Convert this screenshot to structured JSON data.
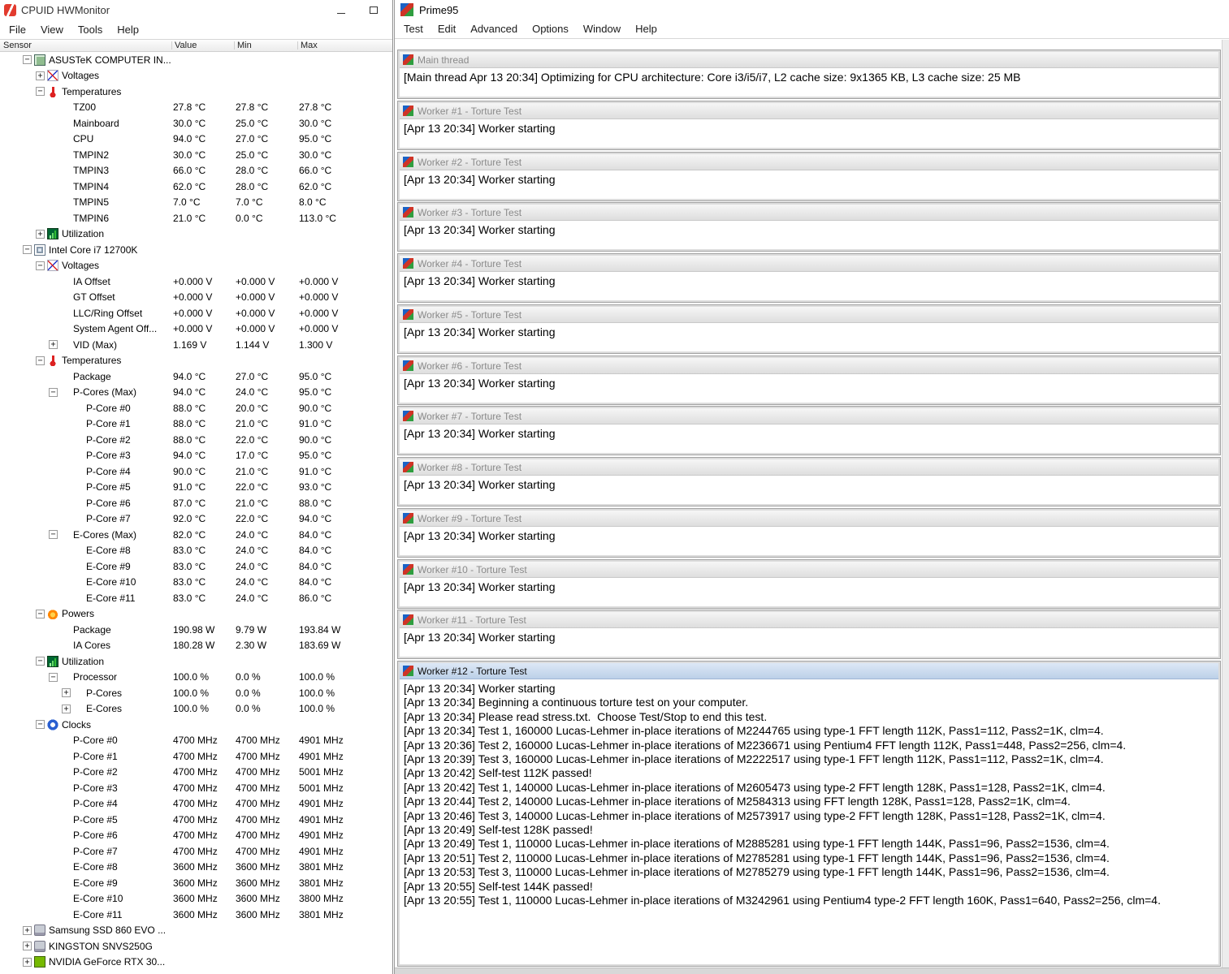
{
  "colors": {
    "active_child_titlebar": "#c6d9f1",
    "inactive_child_titlebar": "#e3e3e3",
    "hwmonitor_icon_red": "#e23b2e",
    "nvidia_green": "#76b900"
  },
  "hwmonitor": {
    "title": "CPUID HWMonitor",
    "menus": [
      "File",
      "View",
      "Tools",
      "Help"
    ],
    "columns": [
      "Sensor",
      "Value",
      "Min",
      "Max"
    ],
    "window_buttons": [
      "minimize-icon",
      "maximize-icon"
    ],
    "rows": [
      {
        "label": "ASUSTeK COMPUTER IN...",
        "level": 0,
        "exp": "open",
        "icon": "mainboard-icon",
        "value": "",
        "min": "",
        "max": ""
      },
      {
        "label": "Voltages",
        "level": 1,
        "exp": "closed",
        "icon": "voltage-icon",
        "value": "",
        "min": "",
        "max": ""
      },
      {
        "label": "Temperatures",
        "level": 1,
        "exp": "open",
        "icon": "temperature-icon",
        "value": "",
        "min": "",
        "max": ""
      },
      {
        "label": "TZ00",
        "level": 2,
        "exp": "",
        "icon": "",
        "value": "27.8 °C",
        "min": "27.8 °C",
        "max": "27.8 °C"
      },
      {
        "label": "Mainboard",
        "level": 2,
        "exp": "",
        "icon": "",
        "value": "30.0 °C",
        "min": "25.0 °C",
        "max": "30.0 °C"
      },
      {
        "label": "CPU",
        "level": 2,
        "exp": "",
        "icon": "",
        "value": "94.0 °C",
        "min": "27.0 °C",
        "max": "95.0 °C"
      },
      {
        "label": "TMPIN2",
        "level": 2,
        "exp": "",
        "icon": "",
        "value": "30.0 °C",
        "min": "25.0 °C",
        "max": "30.0 °C"
      },
      {
        "label": "TMPIN3",
        "level": 2,
        "exp": "",
        "icon": "",
        "value": "66.0 °C",
        "min": "28.0 °C",
        "max": "66.0 °C"
      },
      {
        "label": "TMPIN4",
        "level": 2,
        "exp": "",
        "icon": "",
        "value": "62.0 °C",
        "min": "28.0 °C",
        "max": "62.0 °C"
      },
      {
        "label": "TMPIN5",
        "level": 2,
        "exp": "",
        "icon": "",
        "value": "7.0 °C",
        "min": "7.0 °C",
        "max": "8.0 °C"
      },
      {
        "label": "TMPIN6",
        "level": 2,
        "exp": "",
        "icon": "",
        "value": "21.0 °C",
        "min": "0.0 °C",
        "max": "113.0 °C"
      },
      {
        "label": "Utilization",
        "level": 1,
        "exp": "closed",
        "icon": "utilization-icon",
        "value": "",
        "min": "",
        "max": ""
      },
      {
        "label": "Intel Core i7 12700K",
        "level": 0,
        "exp": "open",
        "icon": "cpu-icon",
        "value": "",
        "min": "",
        "max": ""
      },
      {
        "label": "Voltages",
        "level": 1,
        "exp": "open",
        "icon": "voltage-icon",
        "value": "",
        "min": "",
        "max": ""
      },
      {
        "label": "IA Offset",
        "level": 2,
        "exp": "",
        "icon": "",
        "value": "+0.000 V",
        "min": "+0.000 V",
        "max": "+0.000 V"
      },
      {
        "label": "GT Offset",
        "level": 2,
        "exp": "",
        "icon": "",
        "value": "+0.000 V",
        "min": "+0.000 V",
        "max": "+0.000 V"
      },
      {
        "label": "LLC/Ring Offset",
        "level": 2,
        "exp": "",
        "icon": "",
        "value": "+0.000 V",
        "min": "+0.000 V",
        "max": "+0.000 V"
      },
      {
        "label": "System Agent Off...",
        "level": 2,
        "exp": "",
        "icon": "",
        "value": "+0.000 V",
        "min": "+0.000 V",
        "max": "+0.000 V"
      },
      {
        "label": "VID (Max)",
        "level": 2,
        "exp": "closed",
        "icon": "",
        "value": "1.169 V",
        "min": "1.144 V",
        "max": "1.300 V"
      },
      {
        "label": "Temperatures",
        "level": 1,
        "exp": "open",
        "icon": "temperature-icon",
        "value": "",
        "min": "",
        "max": ""
      },
      {
        "label": "Package",
        "level": 2,
        "exp": "",
        "icon": "",
        "value": "94.0 °C",
        "min": "27.0 °C",
        "max": "95.0 °C"
      },
      {
        "label": "P-Cores (Max)",
        "level": 2,
        "exp": "open",
        "icon": "",
        "value": "94.0 °C",
        "min": "24.0 °C",
        "max": "95.0 °C"
      },
      {
        "label": "P-Core #0",
        "level": 3,
        "exp": "",
        "icon": "",
        "value": "88.0 °C",
        "min": "20.0 °C",
        "max": "90.0 °C"
      },
      {
        "label": "P-Core #1",
        "level": 3,
        "exp": "",
        "icon": "",
        "value": "88.0 °C",
        "min": "21.0 °C",
        "max": "91.0 °C"
      },
      {
        "label": "P-Core #2",
        "level": 3,
        "exp": "",
        "icon": "",
        "value": "88.0 °C",
        "min": "22.0 °C",
        "max": "90.0 °C"
      },
      {
        "label": "P-Core #3",
        "level": 3,
        "exp": "",
        "icon": "",
        "value": "94.0 °C",
        "min": "17.0 °C",
        "max": "95.0 °C"
      },
      {
        "label": "P-Core #4",
        "level": 3,
        "exp": "",
        "icon": "",
        "value": "90.0 °C",
        "min": "21.0 °C",
        "max": "91.0 °C"
      },
      {
        "label": "P-Core #5",
        "level": 3,
        "exp": "",
        "icon": "",
        "value": "91.0 °C",
        "min": "22.0 °C",
        "max": "93.0 °C"
      },
      {
        "label": "P-Core #6",
        "level": 3,
        "exp": "",
        "icon": "",
        "value": "87.0 °C",
        "min": "21.0 °C",
        "max": "88.0 °C"
      },
      {
        "label": "P-Core #7",
        "level": 3,
        "exp": "",
        "icon": "",
        "value": "92.0 °C",
        "min": "22.0 °C",
        "max": "94.0 °C"
      },
      {
        "label": "E-Cores (Max)",
        "level": 2,
        "exp": "open",
        "icon": "",
        "value": "82.0 °C",
        "min": "24.0 °C",
        "max": "84.0 °C"
      },
      {
        "label": "E-Core #8",
        "level": 3,
        "exp": "",
        "icon": "",
        "value": "83.0 °C",
        "min": "24.0 °C",
        "max": "84.0 °C"
      },
      {
        "label": "E-Core #9",
        "level": 3,
        "exp": "",
        "icon": "",
        "value": "83.0 °C",
        "min": "24.0 °C",
        "max": "84.0 °C"
      },
      {
        "label": "E-Core #10",
        "level": 3,
        "exp": "",
        "icon": "",
        "value": "83.0 °C",
        "min": "24.0 °C",
        "max": "84.0 °C"
      },
      {
        "label": "E-Core #11",
        "level": 3,
        "exp": "",
        "icon": "",
        "value": "83.0 °C",
        "min": "24.0 °C",
        "max": "86.0 °C"
      },
      {
        "label": "Powers",
        "level": 1,
        "exp": "open",
        "icon": "power-icon",
        "value": "",
        "min": "",
        "max": ""
      },
      {
        "label": "Package",
        "level": 2,
        "exp": "",
        "icon": "",
        "value": "190.98 W",
        "min": "9.79 W",
        "max": "193.84 W"
      },
      {
        "label": "IA Cores",
        "level": 2,
        "exp": "",
        "icon": "",
        "value": "180.28 W",
        "min": "2.30 W",
        "max": "183.69 W"
      },
      {
        "label": "Utilization",
        "level": 1,
        "exp": "open",
        "icon": "utilization-icon",
        "value": "",
        "min": "",
        "max": ""
      },
      {
        "label": "Processor",
        "level": 2,
        "exp": "open",
        "icon": "",
        "value": "100.0 %",
        "min": "0.0 %",
        "max": "100.0 %"
      },
      {
        "label": "P-Cores",
        "level": 3,
        "exp": "closed",
        "icon": "",
        "value": "100.0 %",
        "min": "0.0 %",
        "max": "100.0 %"
      },
      {
        "label": "E-Cores",
        "level": 3,
        "exp": "closed",
        "icon": "",
        "value": "100.0 %",
        "min": "0.0 %",
        "max": "100.0 %"
      },
      {
        "label": "Clocks",
        "level": 1,
        "exp": "open",
        "icon": "clock-icon",
        "value": "",
        "min": "",
        "max": ""
      },
      {
        "label": "P-Core #0",
        "level": 2,
        "exp": "",
        "icon": "",
        "value": "4700 MHz",
        "min": "4700 MHz",
        "max": "4901 MHz"
      },
      {
        "label": "P-Core #1",
        "level": 2,
        "exp": "",
        "icon": "",
        "value": "4700 MHz",
        "min": "4700 MHz",
        "max": "4901 MHz"
      },
      {
        "label": "P-Core #2",
        "level": 2,
        "exp": "",
        "icon": "",
        "value": "4700 MHz",
        "min": "4700 MHz",
        "max": "5001 MHz"
      },
      {
        "label": "P-Core #3",
        "level": 2,
        "exp": "",
        "icon": "",
        "value": "4700 MHz",
        "min": "4700 MHz",
        "max": "5001 MHz"
      },
      {
        "label": "P-Core #4",
        "level": 2,
        "exp": "",
        "icon": "",
        "value": "4700 MHz",
        "min": "4700 MHz",
        "max": "4901 MHz"
      },
      {
        "label": "P-Core #5",
        "level": 2,
        "exp": "",
        "icon": "",
        "value": "4700 MHz",
        "min": "4700 MHz",
        "max": "4901 MHz"
      },
      {
        "label": "P-Core #6",
        "level": 2,
        "exp": "",
        "icon": "",
        "value": "4700 MHz",
        "min": "4700 MHz",
        "max": "4901 MHz"
      },
      {
        "label": "P-Core #7",
        "level": 2,
        "exp": "",
        "icon": "",
        "value": "4700 MHz",
        "min": "4700 MHz",
        "max": "4901 MHz"
      },
      {
        "label": "E-Core #8",
        "level": 2,
        "exp": "",
        "icon": "",
        "value": "3600 MHz",
        "min": "3600 MHz",
        "max": "3801 MHz"
      },
      {
        "label": "E-Core #9",
        "level": 2,
        "exp": "",
        "icon": "",
        "value": "3600 MHz",
        "min": "3600 MHz",
        "max": "3801 MHz"
      },
      {
        "label": "E-Core #10",
        "level": 2,
        "exp": "",
        "icon": "",
        "value": "3600 MHz",
        "min": "3600 MHz",
        "max": "3800 MHz"
      },
      {
        "label": "E-Core #11",
        "level": 2,
        "exp": "",
        "icon": "",
        "value": "3600 MHz",
        "min": "3600 MHz",
        "max": "3801 MHz"
      },
      {
        "label": "Samsung SSD 860 EVO ...",
        "level": 0,
        "exp": "closed",
        "icon": "disk-icon",
        "value": "",
        "min": "",
        "max": ""
      },
      {
        "label": "KINGSTON SNVS250G",
        "level": 0,
        "exp": "closed",
        "icon": "disk-icon",
        "value": "",
        "min": "",
        "max": ""
      },
      {
        "label": "NVIDIA GeForce RTX 30...",
        "level": 0,
        "exp": "closed",
        "icon": "gpu-icon",
        "value": "",
        "min": "",
        "max": ""
      }
    ]
  },
  "prime95": {
    "title": "Prime95",
    "menus": [
      "Test",
      "Edit",
      "Advanced",
      "Options",
      "Window",
      "Help"
    ],
    "windows": [
      {
        "title": "Main thread",
        "active": false,
        "lines": [
          "[Main thread Apr 13 20:34] Optimizing for CPU architecture: Core i3/i5/i7, L2 cache size: 9x1365 KB, L3 cache size: 25 MB"
        ]
      },
      {
        "title": "Worker #1 - Torture Test",
        "active": false,
        "lines": [
          "[Apr 13 20:34] Worker starting"
        ]
      },
      {
        "title": "Worker #2 - Torture Test",
        "active": false,
        "lines": [
          "[Apr 13 20:34] Worker starting"
        ]
      },
      {
        "title": "Worker #3 - Torture Test",
        "active": false,
        "lines": [
          "[Apr 13 20:34] Worker starting"
        ]
      },
      {
        "title": "Worker #4 - Torture Test",
        "active": false,
        "lines": [
          "[Apr 13 20:34] Worker starting"
        ]
      },
      {
        "title": "Worker #5 - Torture Test",
        "active": false,
        "lines": [
          "[Apr 13 20:34] Worker starting"
        ]
      },
      {
        "title": "Worker #6 - Torture Test",
        "active": false,
        "lines": [
          "[Apr 13 20:34] Worker starting"
        ]
      },
      {
        "title": "Worker #7 - Torture Test",
        "active": false,
        "lines": [
          "[Apr 13 20:34] Worker starting"
        ]
      },
      {
        "title": "Worker #8 - Torture Test",
        "active": false,
        "lines": [
          "[Apr 13 20:34] Worker starting"
        ]
      },
      {
        "title": "Worker #9 - Torture Test",
        "active": false,
        "lines": [
          "[Apr 13 20:34] Worker starting"
        ]
      },
      {
        "title": "Worker #10 - Torture Test",
        "active": false,
        "lines": [
          "[Apr 13 20:34] Worker starting"
        ]
      },
      {
        "title": "Worker #11 - Torture Test",
        "active": false,
        "lines": [
          "[Apr 13 20:34] Worker starting"
        ]
      },
      {
        "title": "Worker #12 - Torture Test",
        "active": true,
        "lines": [
          "[Apr 13 20:34] Worker starting",
          "[Apr 13 20:34] Beginning a continuous torture test on your computer.",
          "[Apr 13 20:34] Please read stress.txt.  Choose Test/Stop to end this test.",
          "[Apr 13 20:34] Test 1, 160000 Lucas-Lehmer in-place iterations of M2244765 using type-1 FFT length 112K, Pass1=112, Pass2=1K, clm=4.",
          "[Apr 13 20:36] Test 2, 160000 Lucas-Lehmer in-place iterations of M2236671 using Pentium4 FFT length 112K, Pass1=448, Pass2=256, clm=4.",
          "[Apr 13 20:39] Test 3, 160000 Lucas-Lehmer in-place iterations of M2222517 using type-1 FFT length 112K, Pass1=112, Pass2=1K, clm=4.",
          "[Apr 13 20:42] Self-test 112K passed!",
          "[Apr 13 20:42] Test 1, 140000 Lucas-Lehmer in-place iterations of M2605473 using type-2 FFT length 128K, Pass1=128, Pass2=1K, clm=4.",
          "[Apr 13 20:44] Test 2, 140000 Lucas-Lehmer in-place iterations of M2584313 using FFT length 128K, Pass1=128, Pass2=1K, clm=4.",
          "[Apr 13 20:46] Test 3, 140000 Lucas-Lehmer in-place iterations of M2573917 using type-2 FFT length 128K, Pass1=128, Pass2=1K, clm=4.",
          "[Apr 13 20:49] Self-test 128K passed!",
          "[Apr 13 20:49] Test 1, 110000 Lucas-Lehmer in-place iterations of M2885281 using type-1 FFT length 144K, Pass1=96, Pass2=1536, clm=4.",
          "[Apr 13 20:51] Test 2, 110000 Lucas-Lehmer in-place iterations of M2785281 using type-1 FFT length 144K, Pass1=96, Pass2=1536, clm=4.",
          "[Apr 13 20:53] Test 3, 110000 Lucas-Lehmer in-place iterations of M2785279 using type-1 FFT length 144K, Pass1=96, Pass2=1536, clm=4.",
          "[Apr 13 20:55] Self-test 144K passed!",
          "[Apr 13 20:55] Test 1, 110000 Lucas-Lehmer in-place iterations of M3242961 using Pentium4 type-2 FFT length 160K, Pass1=640, Pass2=256, clm=4."
        ]
      }
    ]
  }
}
